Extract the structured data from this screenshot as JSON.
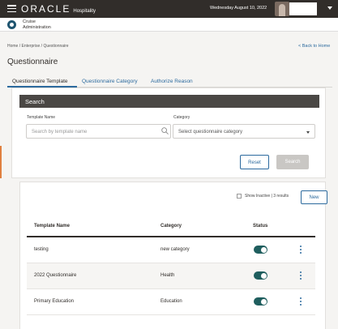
{
  "topbar": {
    "brand": "ORACLE",
    "brand_sub": "Hospitality",
    "date": "Wednesday August 10, 2022",
    "menu_icon": "hamburger-icon",
    "user_icon": "avatar"
  },
  "app": {
    "name_line1": "Cruise",
    "name_line2": "Administration",
    "icon": "cruise-logo-icon"
  },
  "breadcrumb": "Home / Enterprise / Questionnaire",
  "back_link": "< Back to Home",
  "page_title": "Questionnaire",
  "tabs": [
    {
      "label": "Questionnaire Template",
      "active": true
    },
    {
      "label": "Questionnaire Category",
      "active": false
    },
    {
      "label": "Authorize Reason",
      "active": false
    }
  ],
  "search": {
    "header": "Search",
    "template_label": "Template Name",
    "template_placeholder": "Search by template name",
    "category_label": "Category",
    "category_placeholder": "Select questionnaire category",
    "reset_label": "Reset",
    "search_label": "Search"
  },
  "results": {
    "show_inactive_label": "Show Inactive | 3 results",
    "new_label": "New",
    "columns": [
      "Template Name",
      "Category",
      "Status"
    ],
    "rows": [
      {
        "name": "testing",
        "category": "new category",
        "status": "active"
      },
      {
        "name": "2022 Questionnaire",
        "category": "Health",
        "status": "active"
      },
      {
        "name": "Primary Education",
        "category": "Education",
        "status": "active"
      }
    ]
  },
  "colors": {
    "topbar": "#312d2a",
    "accent": "#2c6a9e",
    "toggle_on": "#1f5e5e"
  }
}
